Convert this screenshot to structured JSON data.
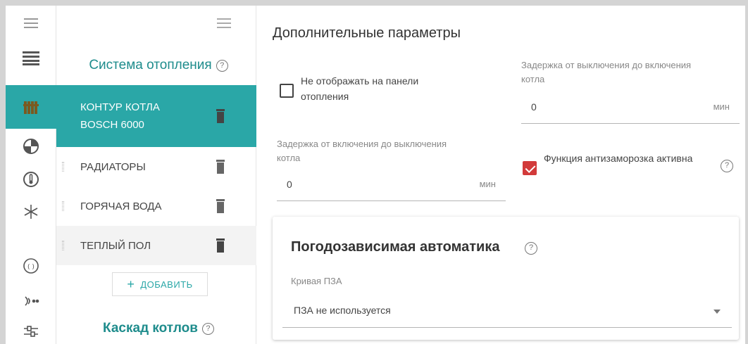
{
  "sidebar": {
    "system_title": "Система отопления",
    "circuits": [
      {
        "label": "КОНТУР КОТЛА BOSCH 6000",
        "active": true
      },
      {
        "label": "РАДИАТОРЫ",
        "active": false
      },
      {
        "label": "ГОРЯЧАЯ ВОДА",
        "active": false
      },
      {
        "label": "ТЕПЛЫЙ ПОЛ",
        "active": false
      }
    ],
    "add_label": "ДОБАВИТЬ",
    "cascade_title": "Каскад котлов"
  },
  "main": {
    "title": "Дополнительные параметры",
    "hide_panel": {
      "label": "Не отображать на панели отопления",
      "checked": false
    },
    "delay_off_on": {
      "label": "Задержка от выключения до включения котла",
      "value": "0",
      "unit": "мин"
    },
    "delay_on_off": {
      "label": "Задержка от включения до выключения котла",
      "value": "0",
      "unit": "мин"
    },
    "antifreeze": {
      "label": "Функция антизаморозка активна",
      "checked": true
    },
    "weather": {
      "title": "Погодозависимая автоматика",
      "curve_label": "Кривая ПЗА",
      "curve_value": "ПЗА не используется"
    }
  },
  "icons": {
    "help": "?",
    "rail": [
      "collapse-icon",
      "menu-list-icon",
      "radiator-icon",
      "palette-icon",
      "thermometer-icon",
      "snowflake-icon",
      "sensor-icon",
      "signal-icon",
      "sliders-icon"
    ]
  },
  "colors": {
    "accent": "#2aa7a7",
    "title": "#1e8c8c",
    "checkbox_on": "#d23a3a"
  }
}
